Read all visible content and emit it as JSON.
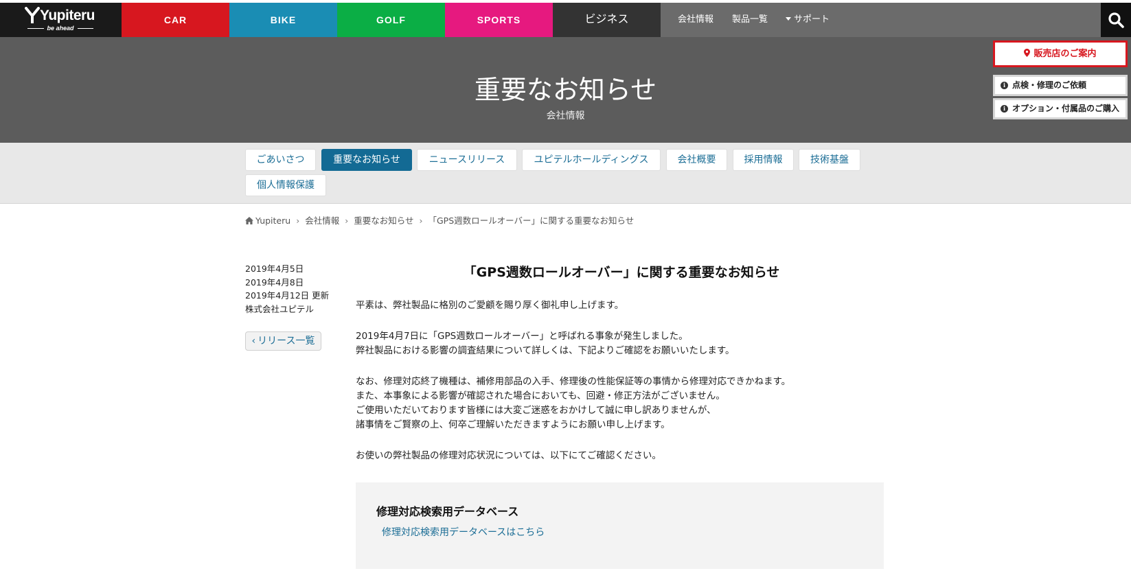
{
  "header": {
    "logo_word": "Yupiteru",
    "logo_tagline": "be ahead",
    "categories": [
      "CAR",
      "BIKE",
      "GOLF",
      "SPORTS",
      "ビジネス"
    ],
    "utility_links": [
      "会社情報",
      "製品一覧",
      "サポート"
    ],
    "colors": {
      "car": "#d7171f",
      "bike": "#1a8db4",
      "golf": "#0bae45",
      "sports": "#e6197f",
      "business": "#333333"
    }
  },
  "hero": {
    "title": "重要なお知らせ",
    "subtitle": "会社情報"
  },
  "side_buttons": {
    "dealer": "販売店のご案内",
    "repair": "点検・修理のご依頼",
    "options": "オプション・付属品のご購入"
  },
  "tabs": [
    "ごあいさつ",
    "重要なお知らせ",
    "ニュースリリース",
    "ユピテルホールディングス",
    "会社概要",
    "採用情報",
    "技術基盤",
    "個人情報保護"
  ],
  "active_tab": "重要なお知らせ",
  "breadcrumb": [
    "Yupiteru",
    "会社情報",
    "重要なお知らせ",
    "「GPS週数ロールオーバー」に関する重要なお知らせ"
  ],
  "meta": {
    "date1": "2019年4月5日",
    "date2": "2019年4月8日",
    "date3": "2019年4月12日 更新",
    "company": "株式会社ユピテル",
    "back_label": "リリース一覧"
  },
  "article": {
    "title": "「GPS週数ロールオーバー」に関する重要なお知らせ",
    "p1": [
      "平素は、弊社製品に格別のご愛顧を賜り厚く御礼申し上げます。"
    ],
    "p2": [
      "2019年4月7日に「GPS週数ロールオーバー」と呼ばれる事象が発生しました。",
      "弊社製品における影響の調査結果について詳しくは、下記よりご確認をお願いいたします。"
    ],
    "p3": [
      "なお、修理対応終了機種は、補修用部品の入手、修理後の性能保証等の事情から修理対応できかねます。",
      "また、本事象による影響が確認された場合においても、回避・修正方法がございません。",
      "ご使用いただいております皆様には大変ご迷惑をおかけして誠に申し訳ありませんが、",
      "諸事情をご賢察の上、何卒ご理解いただきますようにお願い申し上げます。"
    ],
    "p4": [
      "お使いの弊社製品の修理対応状況については、以下にてご確認ください。"
    ]
  },
  "database": {
    "title": "修理対応検索用データベース",
    "link": "修理対応検索用データベースはこちら"
  }
}
